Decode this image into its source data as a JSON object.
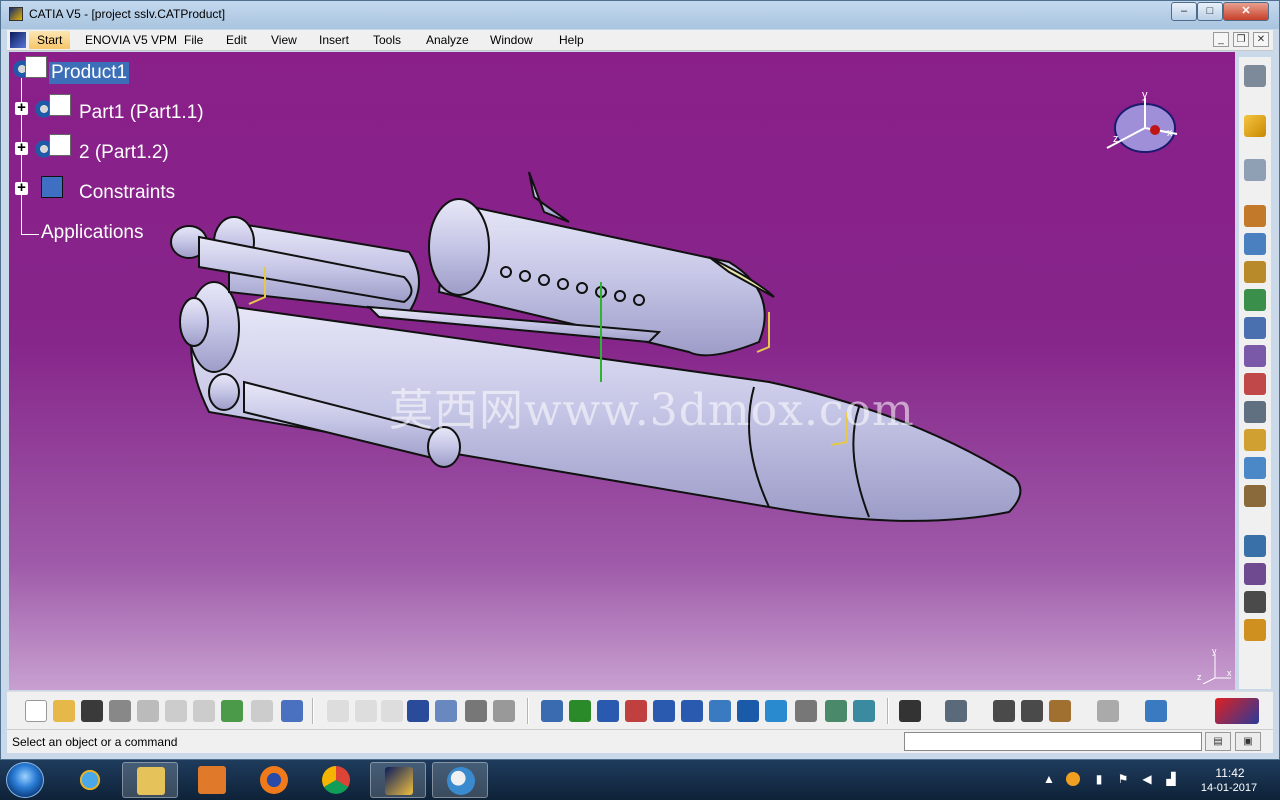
{
  "window": {
    "title": "CATIA V5 - [project sslv.CATProduct]",
    "minimize": "–",
    "maximize": "□",
    "close": "✕"
  },
  "menubar": {
    "items": [
      "Start",
      "ENOVIA V5 VPM",
      "File",
      "Edit",
      "View",
      "Insert",
      "Tools",
      "Analyze",
      "Window",
      "Help"
    ],
    "doc_min": "_",
    "doc_restore": "❐",
    "doc_close": "✕"
  },
  "tree": {
    "nodes": [
      {
        "label": "Product1",
        "icon": "product-icon",
        "selected": true
      },
      {
        "label": "Part1 (Part1.1)",
        "icon": "part-icon"
      },
      {
        "label": "2 (Part1.2)",
        "icon": "part-icon"
      },
      {
        "label": "Constraints",
        "icon": "constraints-icon"
      },
      {
        "label": "Applications",
        "icon": "none"
      }
    ]
  },
  "viewport": {
    "watermark": "莫西网www.3dmox.com",
    "compass_labels": {
      "x": "x",
      "y": "y",
      "z": "z"
    },
    "small_axes": {
      "x": "x",
      "y": "y",
      "z": "z"
    },
    "gradient_top": "#8a1f8a",
    "gradient_bottom": "#c8a0d0"
  },
  "status": {
    "text": "Select an object or a command",
    "input_value": ""
  },
  "taskbar": {
    "time": "11:42",
    "date": "14-01-2017",
    "apps": [
      "ie-icon",
      "explorer-icon",
      "media-player-icon",
      "firefox-icon",
      "chrome-icon",
      "catia-icon",
      "paint-icon"
    ]
  },
  "colors": {
    "selection": "#3d6fb8",
    "model_body": "#c7c7e8",
    "menu_highlight": "#f6c66a"
  }
}
